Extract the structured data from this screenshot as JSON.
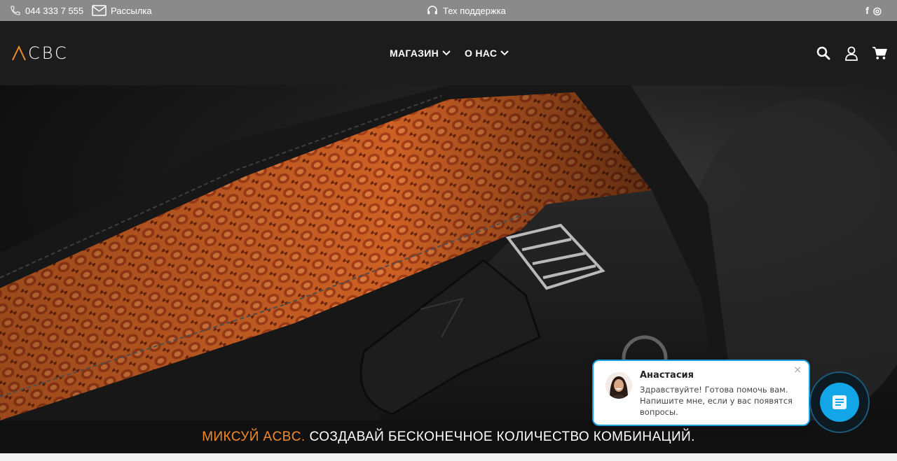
{
  "topbar": {
    "phone": "044 333 7 555",
    "newsletter": "Рассылка",
    "support": "Тех поддержка",
    "social": [
      {
        "icon": "facebook-icon",
        "glyph": "f"
      },
      {
        "icon": "instagram-icon",
        "glyph": "◎"
      }
    ]
  },
  "header": {
    "logo_text": "CBC",
    "nav": [
      {
        "label": "МАГАЗИН"
      },
      {
        "label": "О НАС"
      }
    ]
  },
  "banner": {
    "accent": "МИКСУЙ ACBC.",
    "text": "СОЗДАВАЙ БЕСКОНЕЧНОЕ КОЛИЧЕСТВО КОМБИНАЦИЙ."
  },
  "chat": {
    "name": "Анастасия",
    "message": "Здравствуйте! Готова помочь вам. Напишите мне, если у вас появятся вопросы.",
    "close": "×"
  },
  "colors": {
    "accent": "#f08a2a",
    "topbar": "#8a8a8a",
    "header": "#1c1c1c",
    "chat_blue": "#12a6e8"
  }
}
